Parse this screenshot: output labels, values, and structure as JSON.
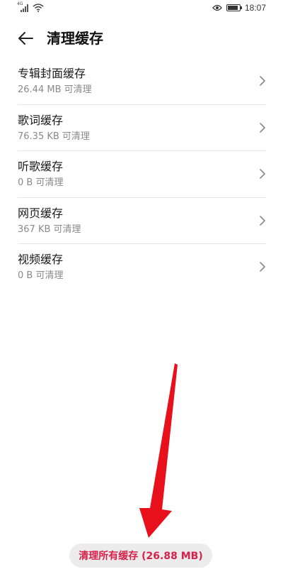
{
  "status_bar": {
    "network_tag": "4G",
    "time": "18:07",
    "icons": [
      "signal-icon",
      "wifi-icon",
      "eye-icon",
      "battery-icon"
    ]
  },
  "header": {
    "title": "清理缓存",
    "back_icon": "back-arrow-icon"
  },
  "cache_items": [
    {
      "title": "专辑封面缓存",
      "subtitle": "26.44 MB 可清理"
    },
    {
      "title": "歌词缓存",
      "subtitle": "76.35 KB 可清理"
    },
    {
      "title": "听歌缓存",
      "subtitle": "0 B 可清理"
    },
    {
      "title": "网页缓存",
      "subtitle": "367 KB 可清理"
    },
    {
      "title": "视频缓存",
      "subtitle": "0 B 可清理"
    }
  ],
  "footer": {
    "clear_all_label": "清理所有缓存 (26.88 MB)"
  },
  "colors": {
    "accent": "#d6224a",
    "annotation_arrow": "#e8101a",
    "button_bg": "#ececec",
    "subtitle": "#8a8a8a"
  }
}
